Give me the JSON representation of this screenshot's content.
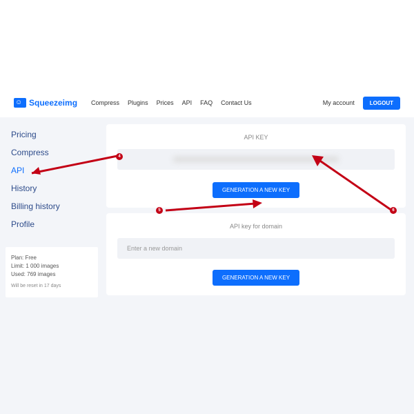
{
  "brand": "Squeezeimg",
  "nav": {
    "items": [
      "Compress",
      "Plugins",
      "Prices",
      "API",
      "FAQ",
      "Contact Us"
    ],
    "my_account": "My account",
    "logout": "LOGOUT"
  },
  "sidebar": {
    "items": [
      {
        "label": "Pricing"
      },
      {
        "label": "Compress"
      },
      {
        "label": "API"
      },
      {
        "label": "History"
      },
      {
        "label": "Billing history"
      },
      {
        "label": "Profile"
      }
    ]
  },
  "plan_info": {
    "plan_line": "Plan: Free",
    "limit_line": "Limit: 1 000 images",
    "used_line": "Used: 769 images",
    "reset_line": "Will be reset in 17 days"
  },
  "api_card": {
    "title": "API KEY",
    "button": "GENERATION A NEW KEY"
  },
  "domain_card": {
    "title": "API key for domain",
    "placeholder": "Enter a new domain",
    "button": "GENERATION A NEW KEY"
  },
  "callouts": {
    "c4": "4",
    "c5": "5",
    "c6": "6"
  }
}
